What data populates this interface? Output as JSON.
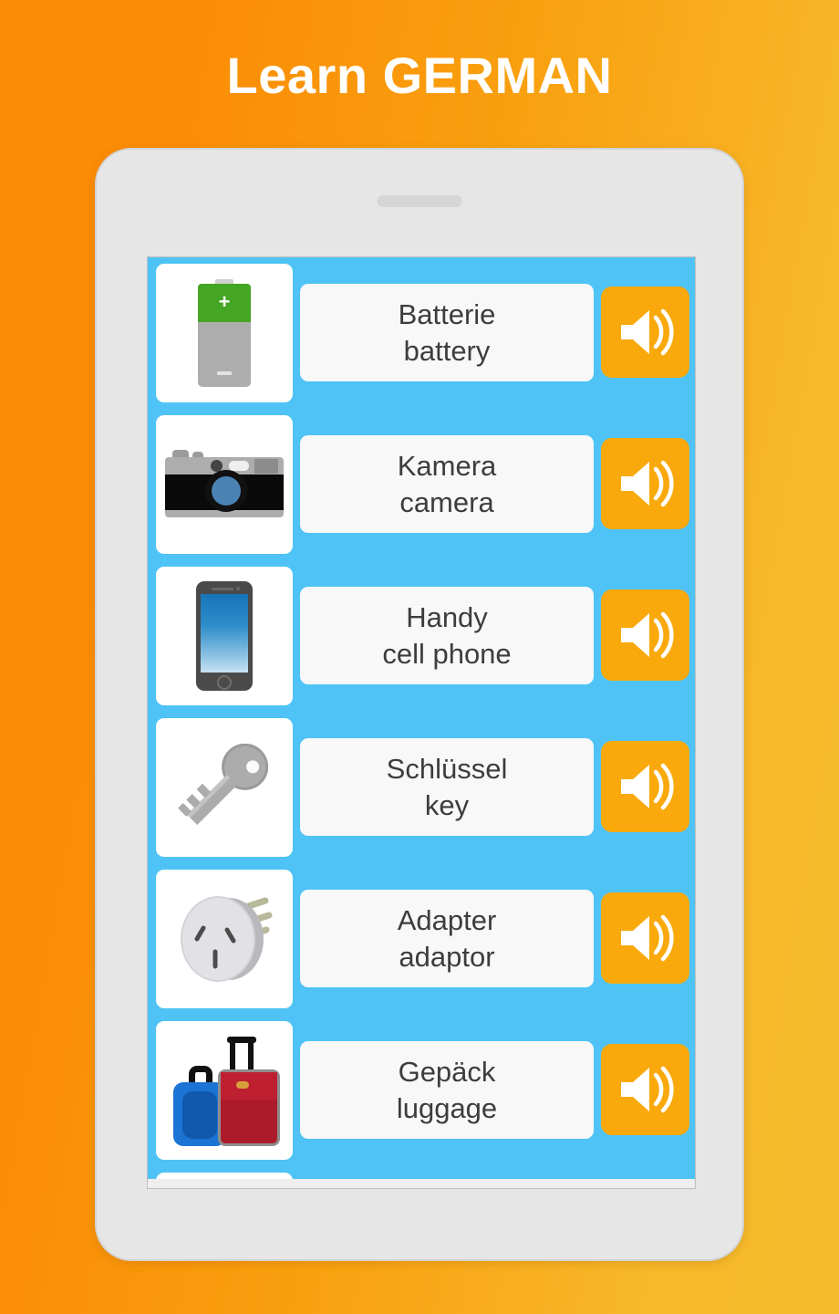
{
  "header": {
    "title": "Learn GERMAN"
  },
  "theme": {
    "background_gradient_start": "#FB8C05",
    "background_gradient_end": "#F6BB2D",
    "screen_background": "#4FC3F5",
    "tablet_body": "#e6e6e6",
    "speaker_button": "#F9A90C",
    "card_background": "#F8F8F8",
    "text_color": "#3D3D3D"
  },
  "device": {
    "name": "tablet-mockup",
    "speaker_slot": "speaker-slot"
  },
  "vocabulary": {
    "play_button_icon": "speaker-icon",
    "items": [
      {
        "icon": "battery-icon",
        "german": "Batterie",
        "english": "battery",
        "play_label": "play-audio"
      },
      {
        "icon": "camera-icon",
        "german": "Kamera",
        "english": "camera",
        "play_label": "play-audio"
      },
      {
        "icon": "cell-phone-icon",
        "german": "Handy",
        "english": "cell phone",
        "play_label": "play-audio"
      },
      {
        "icon": "key-icon",
        "german": "Schlüssel",
        "english": "key",
        "play_label": "play-audio"
      },
      {
        "icon": "power-adapter-icon",
        "german": "Adapter",
        "english": "adaptor",
        "play_label": "play-audio"
      },
      {
        "icon": "luggage-icon",
        "german": "Gepäck",
        "english": "luggage",
        "play_label": "play-audio"
      }
    ]
  }
}
